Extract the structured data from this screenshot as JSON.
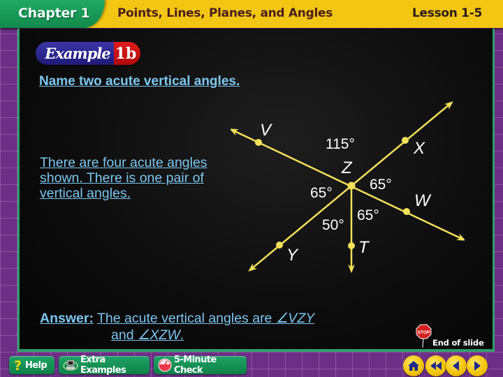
{
  "header": {
    "chapter": "Chapter 1",
    "title": "Points, Lines, Planes, and Angles",
    "lesson": "Lesson 1-5"
  },
  "example": {
    "word": "Example",
    "number": "1b"
  },
  "question": "Name two acute vertical angles.",
  "explanation": "There are four acute angles shown. There is one pair of vertical angles.",
  "answer": {
    "label": "Answer:",
    "text": "The acute vertical angles are ",
    "angle1": "∠VZY",
    "connector": "and ",
    "angle2": "∠XZW",
    "end": "."
  },
  "diagram": {
    "line_color": "#f5e05a",
    "center_point": "Z",
    "points": [
      "V",
      "X",
      "W",
      "Y",
      "T"
    ],
    "angles": [
      {
        "label": "115°",
        "between": "VZX"
      },
      {
        "label": "65°",
        "between": "XZW"
      },
      {
        "label": "65°",
        "between": "VZY"
      },
      {
        "label": "50°",
        "between": "YZT"
      },
      {
        "label": "65°",
        "between": "TZW"
      }
    ]
  },
  "end_of_slide": {
    "label": "End of slide",
    "stop_text": "STOP"
  },
  "toolbar": {
    "help": "Help",
    "extra_examples": "Extra Examples",
    "five_minute_check": "5-Minute Check"
  },
  "nav": [
    "home-icon",
    "first-slide-icon",
    "previous-icon",
    "next-icon"
  ],
  "colors": {
    "header_yellow": "#f3c614",
    "chapter_green": "#1a9a5a",
    "text_blue": "#7cc6ef",
    "background_purple": "#6d2f86",
    "badge_blue": "#2a2590",
    "badge_red": "#cc1111"
  }
}
